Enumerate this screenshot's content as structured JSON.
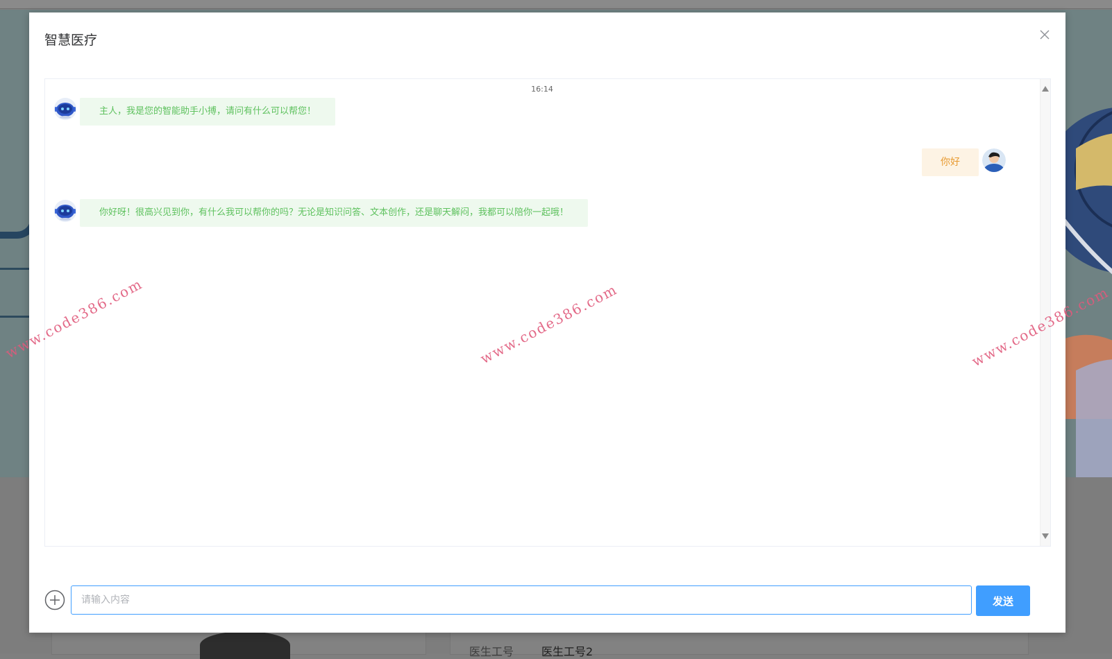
{
  "background": {
    "doctor_id_label": "医生工号",
    "doctor_id_value": "医生工号2"
  },
  "dialog": {
    "title": "智慧医疗",
    "close_icon": "close-icon"
  },
  "chat": {
    "timestamp": "16:14",
    "messages": [
      {
        "sender": "bot",
        "text": "主人，我是您的智能助手小搏，请问有什么可以帮您！"
      },
      {
        "sender": "user",
        "text": "你好"
      },
      {
        "sender": "bot",
        "text": "你好呀！很高兴见到你，有什么我可以帮你的吗？无论是知识问答、文本创作，还是聊天解闷，我都可以陪你一起哦！"
      }
    ]
  },
  "watermark": {
    "text": "www.code386.com"
  },
  "composer": {
    "placeholder": "请输入内容",
    "value": "",
    "send_label": "发送",
    "add_icon": "plus-circle-icon"
  },
  "colors": {
    "accent": "#409eff",
    "bot_bubble_bg": "#eef9ee",
    "bot_text": "#5ec15e",
    "user_bubble_bg": "#fdf3e4",
    "user_text": "#e89b32",
    "watermark": "#e05a7c"
  }
}
